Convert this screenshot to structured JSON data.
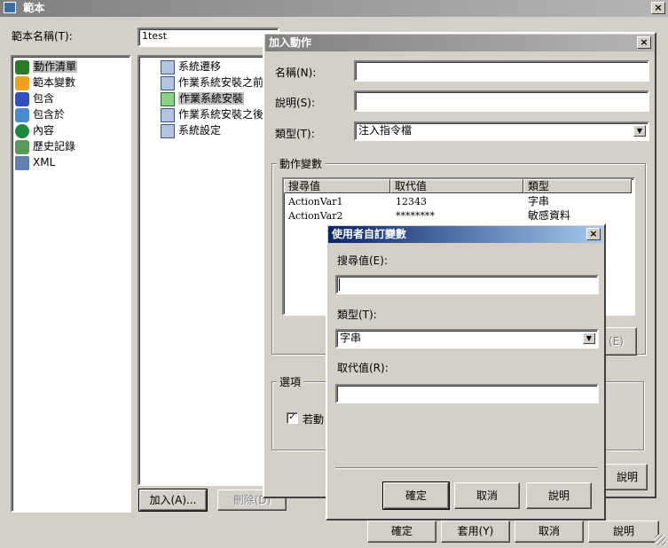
{
  "main_window": {
    "title": "範本",
    "name_label": "範本名稱(T):",
    "name_value": "1test",
    "categories": [
      {
        "label": "動作清單",
        "icon": "gear-list-icon"
      },
      {
        "label": "範本變數",
        "icon": "variable-icon"
      },
      {
        "label": "包含",
        "icon": "include-icon"
      },
      {
        "label": "包含於",
        "icon": "included-in-icon"
      },
      {
        "label": "內容",
        "icon": "info-icon"
      },
      {
        "label": "歷史記錄",
        "icon": "history-icon"
      },
      {
        "label": "XML",
        "icon": "xml-icon"
      }
    ],
    "actions": [
      {
        "label": "系統遷移"
      },
      {
        "label": "作業系統安裝之前"
      },
      {
        "label": "作業系統安裝"
      },
      {
        "label": "作業系統安裝之後"
      },
      {
        "label": "系統設定"
      }
    ],
    "add_button": "加入(A)...",
    "remove_button": "刪除(D)",
    "ok_button": "確定",
    "apply_button": "套用(Y)",
    "cancel_button": "取消",
    "help_button": "說明"
  },
  "add_action_dialog": {
    "title": "加入動作",
    "name_label": "名稱(N):",
    "name_value": "",
    "desc_label": "說明(S):",
    "desc_value": "",
    "type_label": "類型(T):",
    "type_value": "注入指令檔",
    "vars_group": "動作變數",
    "columns": [
      "搜尋值",
      "取代值",
      "類型"
    ],
    "rows": [
      {
        "search": "ActionVar1",
        "replace": "12343",
        "type": "字串"
      },
      {
        "search": "ActionVar2",
        "replace": "********",
        "type": "敏感資料"
      }
    ],
    "partial_button": "(E)",
    "options_group": "選項",
    "checkbox_label": "若動",
    "help_button": "說明"
  },
  "custom_var_dialog": {
    "title": "使用者自訂變數",
    "search_label": "搜尋值(E):",
    "search_value": "",
    "type_label": "類型(T):",
    "type_value": "字串",
    "replace_label": "取代值(R):",
    "replace_value": "",
    "ok_button": "確定",
    "cancel_button": "取消",
    "help_button": "說明"
  },
  "icons": {
    "close": "×",
    "dropdown": "▼",
    "check": "✓"
  },
  "colors": {
    "face": "#d4d0c8",
    "active_title": "#0a246a",
    "inactive_title": "#808080"
  }
}
